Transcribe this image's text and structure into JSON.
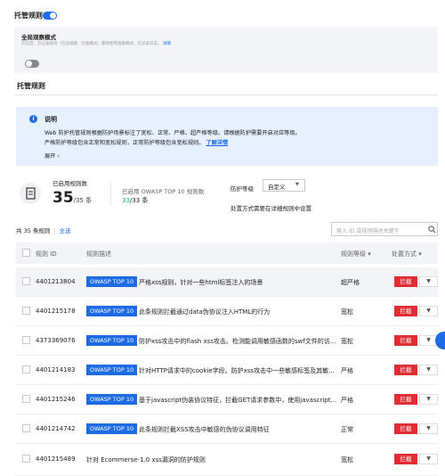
{
  "header": {
    "title": "托管规则",
    "toggle_on": true
  },
  "global_mode": {
    "label": "全局观察模式",
    "desc": "开启后，仅记录规则（包括观察、拦截模式）都将使用观察模式，仅记录日志。",
    "link": "详情",
    "toggle_on": false
  },
  "section_title": "托管规则",
  "info": {
    "title": "说明",
    "line1": "Web 防护托管规则根据防护场景标注了宽松、正常、严格、超严格等级。请根据防护需要开启对应等级。",
    "line2": "严格防护等级包含正常和宽松规则，正常防护等级包含宽松规则。",
    "link": "了解详情",
    "expand": "展开"
  },
  "stats": {
    "enabled_label": "已启用规则数",
    "enabled_count": "35",
    "enabled_total": "/35 条",
    "owasp_label": "已启用 OWASP TOP 10 规则数",
    "owasp_count": "33",
    "owasp_total": "/33 条"
  },
  "level": {
    "label": "防护等级",
    "value": "自定义",
    "hint": "处置方式需要在详细规则中设置"
  },
  "toolbar": {
    "count": "共 35 条规则",
    "select_all": "全选",
    "search_placeholder": "输入 ID 或规则描述关键字"
  },
  "table": {
    "columns": {
      "id": "规则 ID",
      "desc": "规则描述",
      "level": "规则等级",
      "action": "处置方式"
    },
    "rows": [
      {
        "id": "4401213804",
        "tag": "OWASP TOP 10",
        "desc": "严格xss规则，针对一些html标签注入的场景",
        "level": "超严格",
        "action": "拦截"
      },
      {
        "id": "4401215178",
        "tag": "OWASP TOP 10",
        "desc": "此条规则拦截通过data伪协议注入HTML的行为",
        "level": "宽松",
        "action": "拦截"
      },
      {
        "id": "4373369076",
        "tag": "OWASP TOP 10",
        "desc": "防护xss攻击中的flash xss攻击。检测能调用敏感函数的swf文件的访...",
        "level": "宽松",
        "action": "拦截"
      },
      {
        "id": "4401214183",
        "tag": "OWASP TOP 10",
        "desc": "针对HTTP请求中的cookie字段。防护xss攻击中一些敏感标签及其敏...",
        "level": "严格",
        "action": "拦截"
      },
      {
        "id": "4401215246",
        "tag": "OWASP TOP 10",
        "desc": "基于javascript伪装协议特征，拦截GET请求参数中，使用javascript...",
        "level": "严格",
        "action": "拦截"
      },
      {
        "id": "4401214742",
        "tag": "OWASP TOP 10",
        "desc": "此条规则拦截XSS攻击中敏感的伪协议调用特征",
        "level": "正常",
        "action": "拦截"
      },
      {
        "id": "4401215489",
        "tag": "",
        "desc": "针对 Ecommerse-1.0 xss漏洞的防护规则",
        "level": "宽松",
        "action": "拦截"
      }
    ]
  },
  "colors": {
    "primary": "#1e6be6",
    "danger": "#e02c33",
    "success": "#0abf5b"
  }
}
